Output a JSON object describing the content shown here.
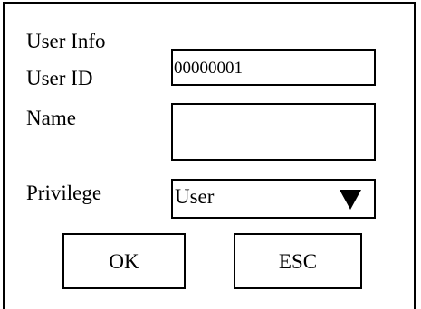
{
  "dialog": {
    "title": "User Info",
    "user_id": {
      "label": "User ID",
      "value": "00000001"
    },
    "name": {
      "label": "Name",
      "value": ""
    },
    "privilege": {
      "label": "Privilege",
      "selected": "User",
      "icon": "triangle-down-icon"
    },
    "buttons": {
      "ok": "OK",
      "esc": "ESC"
    }
  }
}
